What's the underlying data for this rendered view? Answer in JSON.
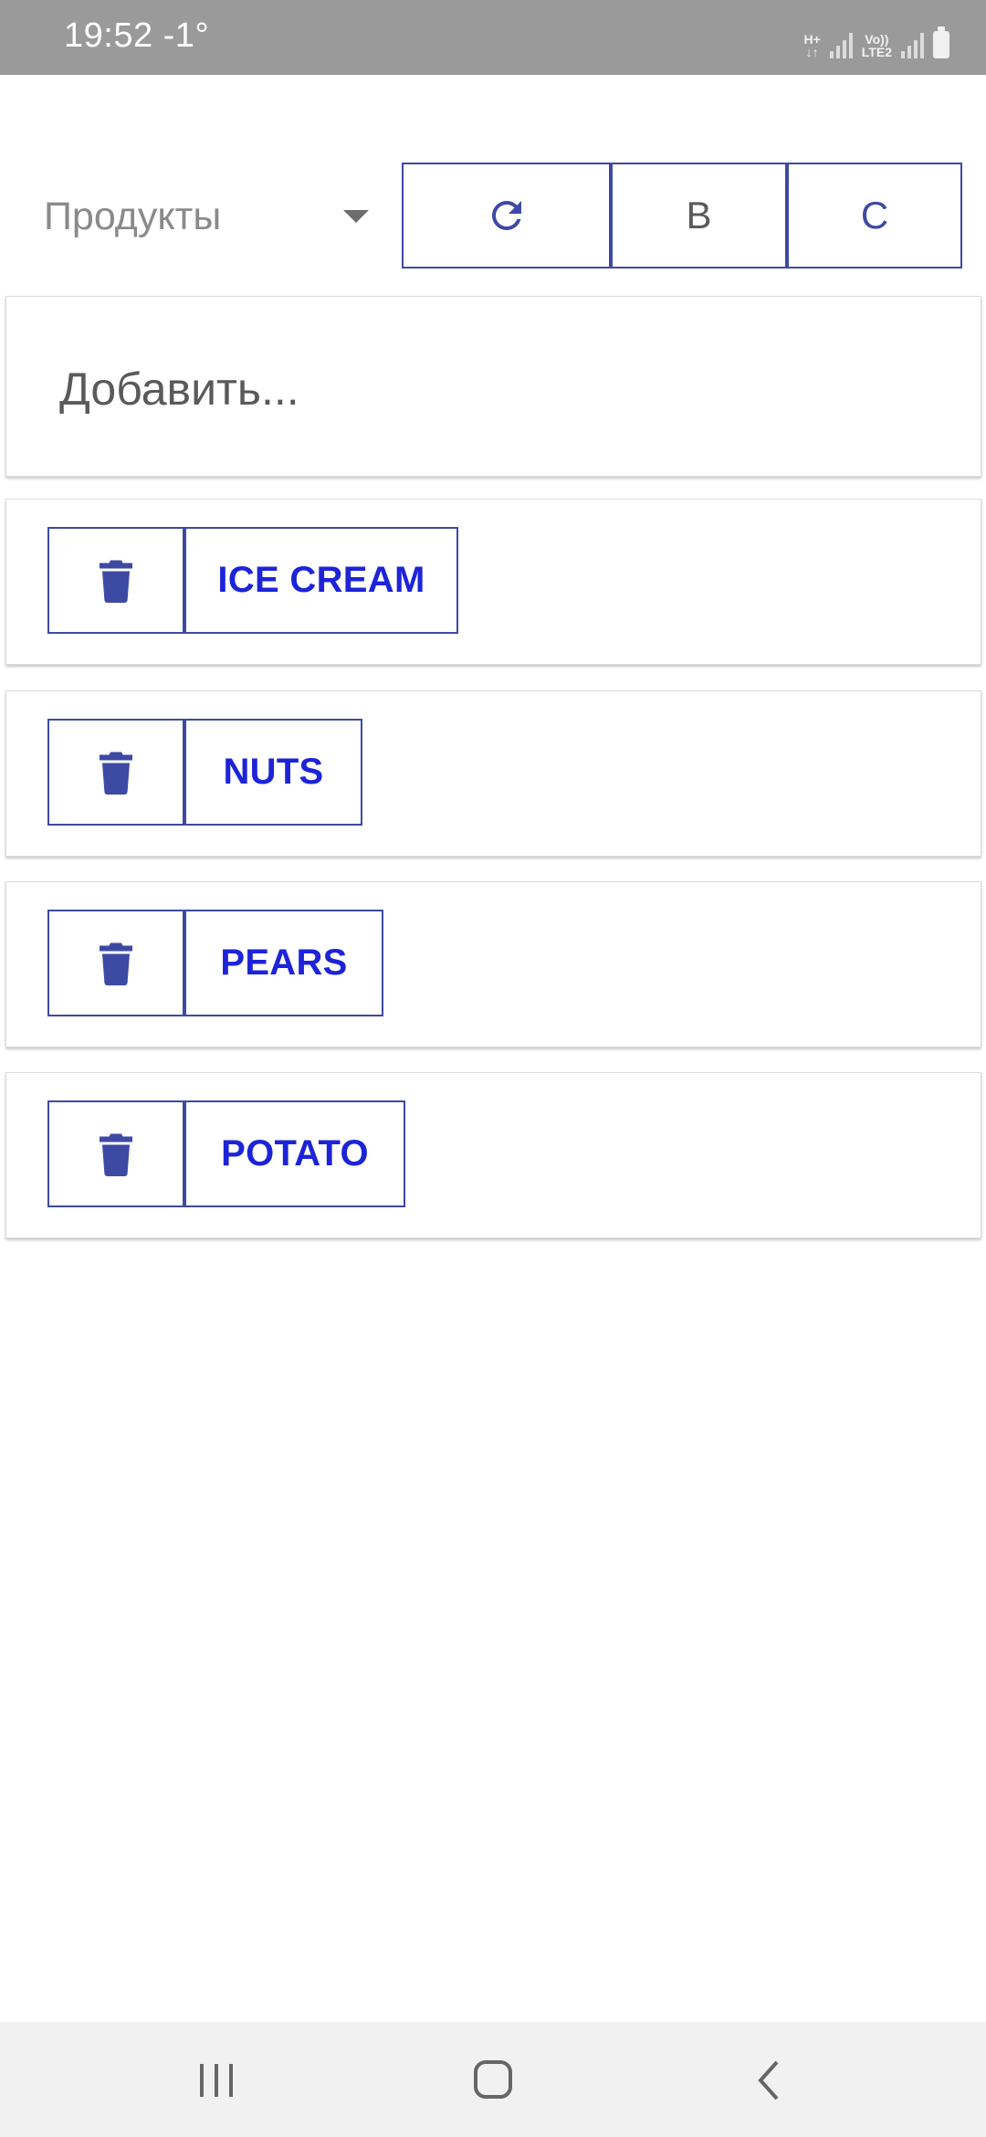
{
  "status_bar": {
    "time": "19:52",
    "temperature": "-1°",
    "network_1": "H+",
    "network_2_line1": "Vo))",
    "network_2_line2": "LTE2"
  },
  "toolbar": {
    "category": "Продукты",
    "button_b": "В",
    "button_c": "С",
    "refresh_icon": "refresh-icon"
  },
  "add_item": {
    "placeholder": "Добавить..."
  },
  "items": [
    {
      "label": "ICE CREAM"
    },
    {
      "label": "NUTS"
    },
    {
      "label": "PEARS"
    },
    {
      "label": "POTATO"
    }
  ],
  "icons": {
    "delete": "trash-icon"
  },
  "colors": {
    "accent": "#3d4aa4",
    "item_text": "#1d24d8",
    "status_bar": "#9a9a9a",
    "nav_bar": "#f1f1f1"
  }
}
